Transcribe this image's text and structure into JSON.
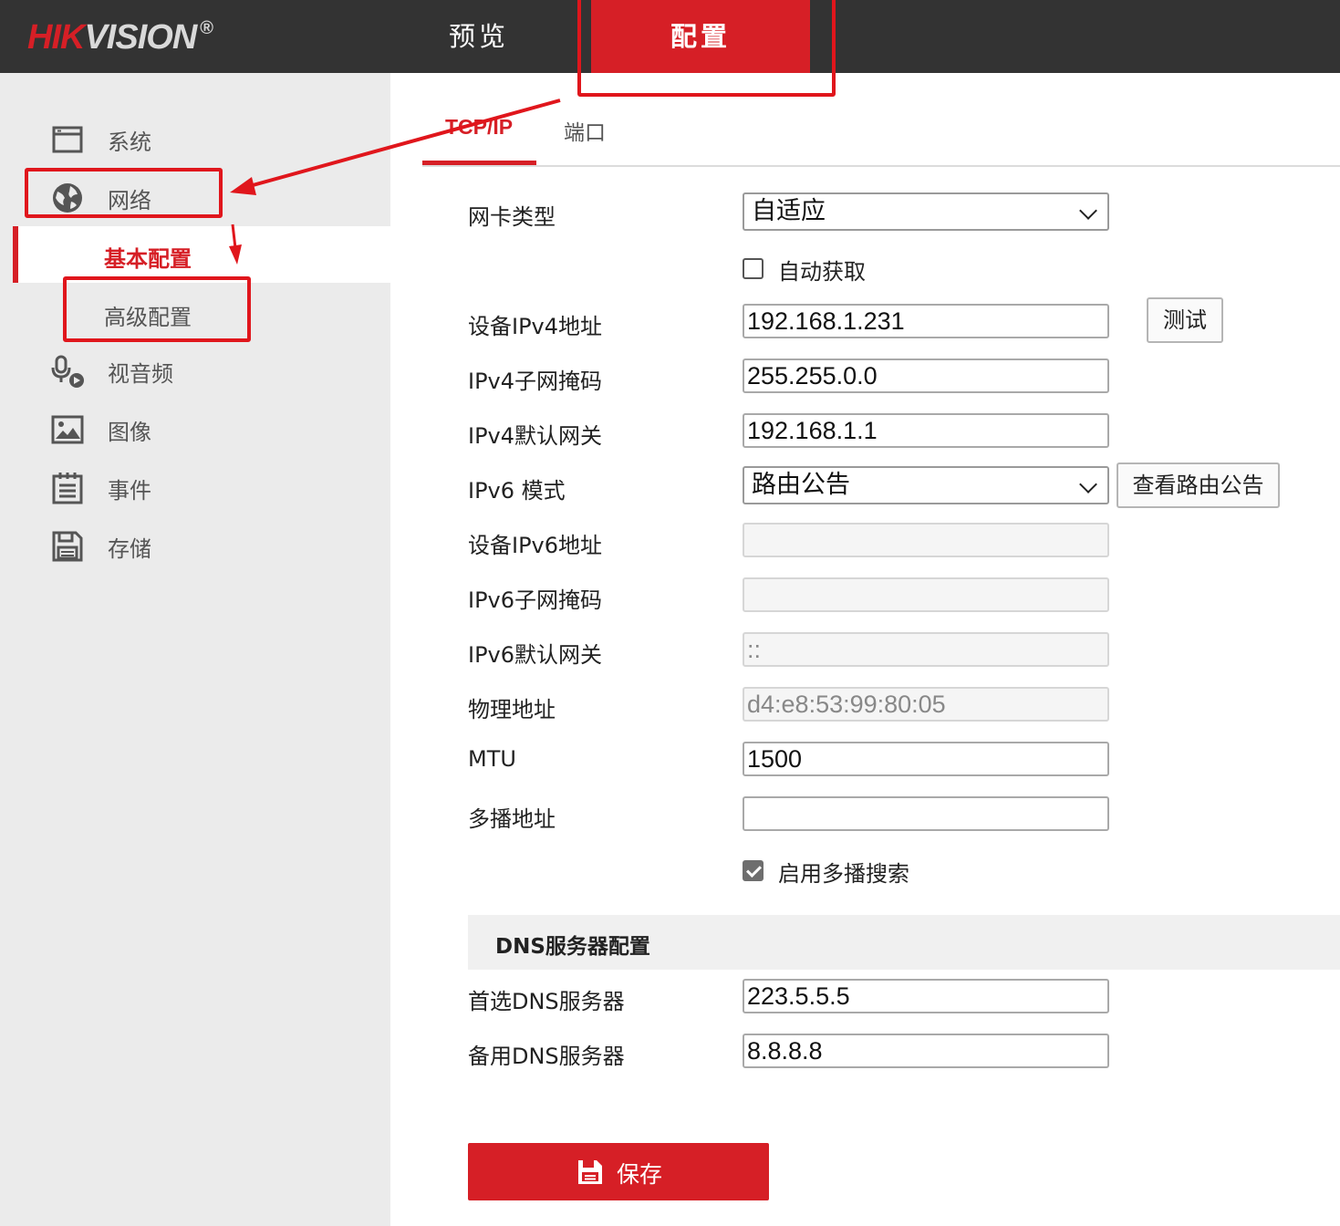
{
  "header": {
    "logo_red": "HIK",
    "logo_grey": "VISION",
    "logo_mark": "®",
    "tabs": [
      {
        "label": "预览",
        "active": false
      },
      {
        "label": "配置",
        "active": true
      }
    ]
  },
  "sidebar": {
    "items": [
      {
        "label": "系统",
        "icon": "window-icon"
      },
      {
        "label": "网络",
        "icon": "globe-icon"
      },
      {
        "label": "视音频",
        "icon": "mic-camera-icon"
      },
      {
        "label": "图像",
        "icon": "image-icon"
      },
      {
        "label": "事件",
        "icon": "calendar-icon"
      },
      {
        "label": "存储",
        "icon": "floppy-icon"
      }
    ],
    "network_sub": [
      {
        "label": "基本配置",
        "active": true
      },
      {
        "label": "高级配置",
        "active": false
      }
    ]
  },
  "tabs": [
    {
      "label": "TCP/IP",
      "active": true
    },
    {
      "label": "端口",
      "active": false
    }
  ],
  "form": {
    "nic_type_label": "网卡类型",
    "nic_type_value": "自适应",
    "dhcp_label": "自动获取",
    "dhcp_checked": false,
    "ipv4_addr_label": "设备IPv4地址",
    "ipv4_addr_value": "192.168.1.231",
    "test_button": "测试",
    "ipv4_mask_label": "IPv4子网掩码",
    "ipv4_mask_value": "255.255.0.0",
    "ipv4_gateway_label": "IPv4默认网关",
    "ipv4_gateway_value": "192.168.1.1",
    "ipv6_mode_label": "IPv6 模式",
    "ipv6_mode_value": "路由公告",
    "view_route_button": "查看路由公告",
    "ipv6_addr_label": "设备IPv6地址",
    "ipv6_addr_value": "",
    "ipv6_mask_label": "IPv6子网掩码",
    "ipv6_mask_value": "",
    "ipv6_gateway_label": "IPv6默认网关",
    "ipv6_gateway_value": "::",
    "mac_label": "物理地址",
    "mac_value": "d4:e8:53:99:80:05",
    "mtu_label": "MTU",
    "mtu_value": "1500",
    "multicast_label": "多播地址",
    "multicast_value": "",
    "multicast_search_label": "启用多播搜索",
    "multicast_search_checked": true
  },
  "dns": {
    "section_title": "DNS服务器配置",
    "primary_label": "首选DNS服务器",
    "primary_value": "223.5.5.5",
    "secondary_label": "备用DNS服务器",
    "secondary_value": "8.8.8.8"
  },
  "save_button": "保存",
  "colors": {
    "brand_red": "#d61f26",
    "topbar": "#333333",
    "sidebar_bg": "#ebebeb",
    "annotation_red": "#e0161c"
  }
}
